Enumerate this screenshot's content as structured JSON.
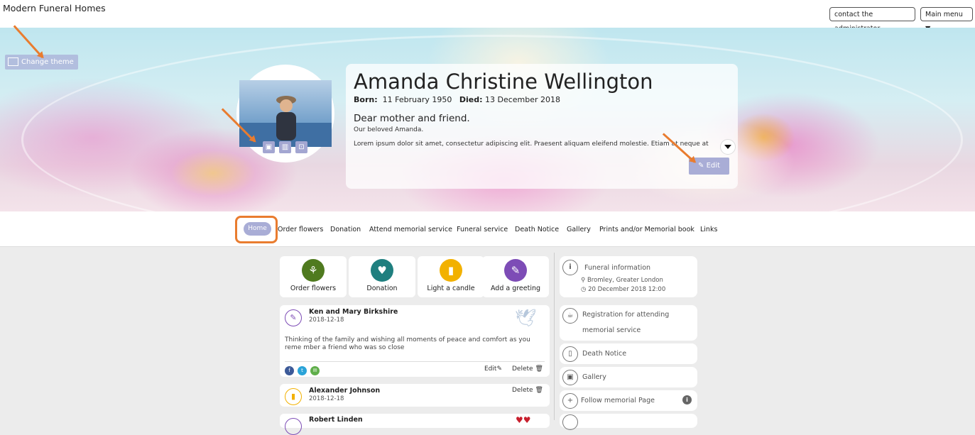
{
  "header": {
    "brand": "Modern Funeral Homes",
    "contact_label": "contact the administrator",
    "menu_label": "Main menu ▼"
  },
  "hero": {
    "change_theme_label": "Change theme",
    "name": "Amanda Christine Wellington",
    "born_label": "Born:",
    "born_date": "11 February 1950",
    "died_label": "Died:",
    "died_date": "13 December 2018",
    "headline": "Dear mother and friend.",
    "subline": "Our beloved Amanda.",
    "lorem": "Lorem ipsum dolor sit amet, consectetur adipiscing elit. Praesent aliquam eleifend molestie. Etiam at neque at est",
    "edit_label": "Edit",
    "share_icons": [
      "f",
      "∞",
      "✉"
    ]
  },
  "nav": {
    "items": [
      "Home",
      "Order flowers",
      "Donation",
      "Attend memorial service",
      "Funeral service",
      "Death Notice",
      "Gallery",
      "Prints and/or Memorial book",
      "Links"
    ]
  },
  "actions": [
    {
      "label": "Order flowers",
      "icon": "⚘",
      "color": "#4f7a1f"
    },
    {
      "label": "Donation",
      "icon": "♥",
      "color": "#1f7f7f"
    },
    {
      "label": "Light a candle",
      "icon": "▮",
      "color": "#f2b100"
    },
    {
      "label": "Add a greeting",
      "icon": "✎",
      "color": "#7d4cb6"
    }
  ],
  "greetings": [
    {
      "name": "Ken and Mary Birkshire",
      "date": "2018-12-18",
      "message": "Thinking of the family and wishing all moments of peace and comfort as you reme mber a friend who was so close",
      "edit": "Edit",
      "delete": "Delete"
    },
    {
      "name": "Alexander Johnson",
      "date": "2018-12-18",
      "delete": "Delete"
    },
    {
      "name": "Robert Linden"
    }
  ],
  "sidebar": {
    "funeral_title": "Funeral information",
    "funeral_location": "Bromley, Greater London",
    "funeral_time": "20 December 2018 12:00",
    "registration_line1": "Registration for attending",
    "registration_line2": "memorial service",
    "death_notice": "Death Notice",
    "gallery": "Gallery",
    "follow": "Follow memorial Page"
  }
}
